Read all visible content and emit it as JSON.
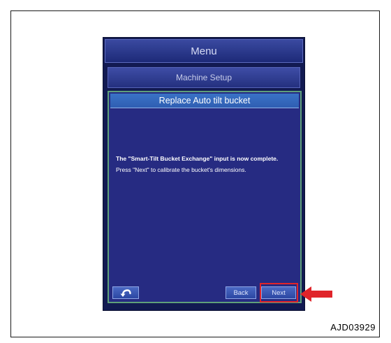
{
  "header": {
    "menu_title": "Menu",
    "section_title": "Machine Setup"
  },
  "dialog": {
    "title": "Replace Auto tilt bucket",
    "message_line1": "The \"Smart-Tilt Bucket Exchange\" input is now complete.",
    "message_line2": "Press \"Next\" to calibrate the bucket's dimensions."
  },
  "buttons": {
    "return_icon": "return-arrow-icon",
    "back_label": "Back",
    "next_label": "Next"
  },
  "annotations": {
    "figure_code": "AJD03929",
    "highlight_color": "#e0242a"
  },
  "colors": {
    "screen_background": "#262b82",
    "title_bar": "#3a73c6",
    "dialog_border": "#5fa07a"
  }
}
